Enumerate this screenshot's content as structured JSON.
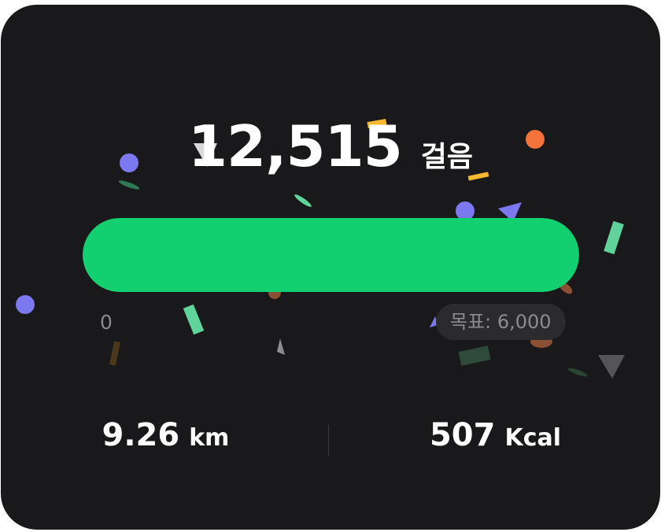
{
  "steps": {
    "value": "12,515",
    "unit": "걸음"
  },
  "progress": {
    "current_steps": 12515,
    "goal_steps": 6000,
    "fill_fraction": 1.0,
    "fill_color": "#12cf70",
    "scale_min_label": "0",
    "goal_label": "목표: 6,000"
  },
  "stats": {
    "distance_value": "9.26",
    "distance_unit": "km",
    "calories_value": "507",
    "calories_unit": "Kcal"
  },
  "colors": {
    "card_background": "#19191b",
    "text_primary": "#ffffff",
    "text_secondary": "#8a8a8e",
    "confetti": [
      "#7b78f0",
      "#f4733a",
      "#f5b82e",
      "#5fd39a",
      "#9b5a3c",
      "#d9d9d9",
      "#2f4a3a",
      "#3a3220"
    ]
  }
}
